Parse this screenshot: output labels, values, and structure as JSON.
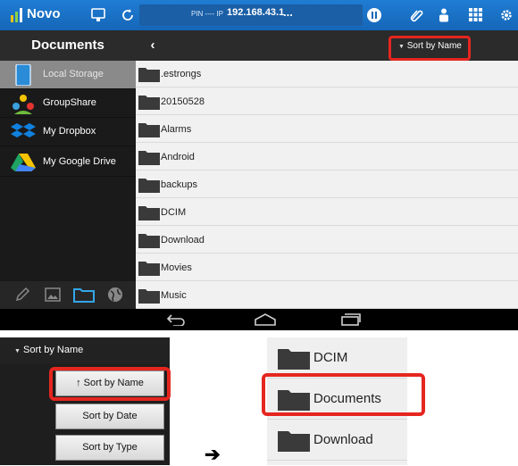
{
  "topbar": {
    "app_name": "Novo",
    "pin_label": "PIN ---- IP",
    "ip": "192.168.43.1",
    "more": "..."
  },
  "sidebar": {
    "title": "Documents",
    "items": [
      {
        "label": "Local Storage",
        "icon": "tablet-icon"
      },
      {
        "label": "GroupShare",
        "icon": "groupshare-icon"
      },
      {
        "label": "My Dropbox",
        "icon": "dropbox-icon"
      },
      {
        "label": "My Google Drive",
        "icon": "google-drive-icon"
      }
    ]
  },
  "toolbar": {
    "back": "‹",
    "sort_label": "Sort by Name"
  },
  "folders": [
    ".estrongs",
    "20150528",
    "Alarms",
    "Android",
    "backups",
    "DCIM",
    "Download",
    "Movies",
    "Music"
  ],
  "sort_panel": {
    "header": "Sort by Name",
    "options": [
      "↑ Sort by Name",
      "Sort by Date",
      "Sort by Type"
    ]
  },
  "result_list": [
    "DCIM",
    "Documents",
    "Download"
  ],
  "arrow": "➔",
  "colors": {
    "accent": "#1f7dd3",
    "highlight": "#e5261f"
  }
}
